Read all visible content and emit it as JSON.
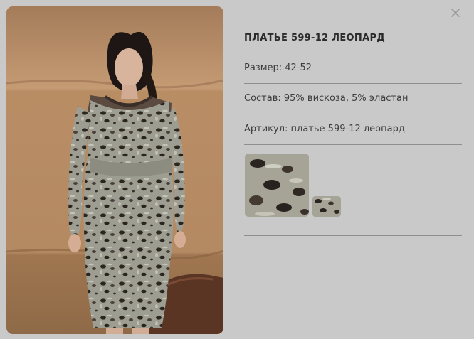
{
  "product": {
    "title": "ПЛАТЬЕ 599-12 ЛЕОПАРД",
    "size": "Размер: 42-52",
    "composition": "Состав: 95% вискоза, 5% эластан",
    "article": "Артикул: платье 599-12 леопард"
  },
  "swatches": [
    "fabric-swatch-large",
    "fabric-swatch-small"
  ],
  "icons": {
    "close": "close-icon"
  },
  "colors": {
    "background": "#c9c9c9",
    "divider": "#8f8f8f",
    "title_text": "#2b2b2b",
    "body_text": "#3d3d3d"
  }
}
